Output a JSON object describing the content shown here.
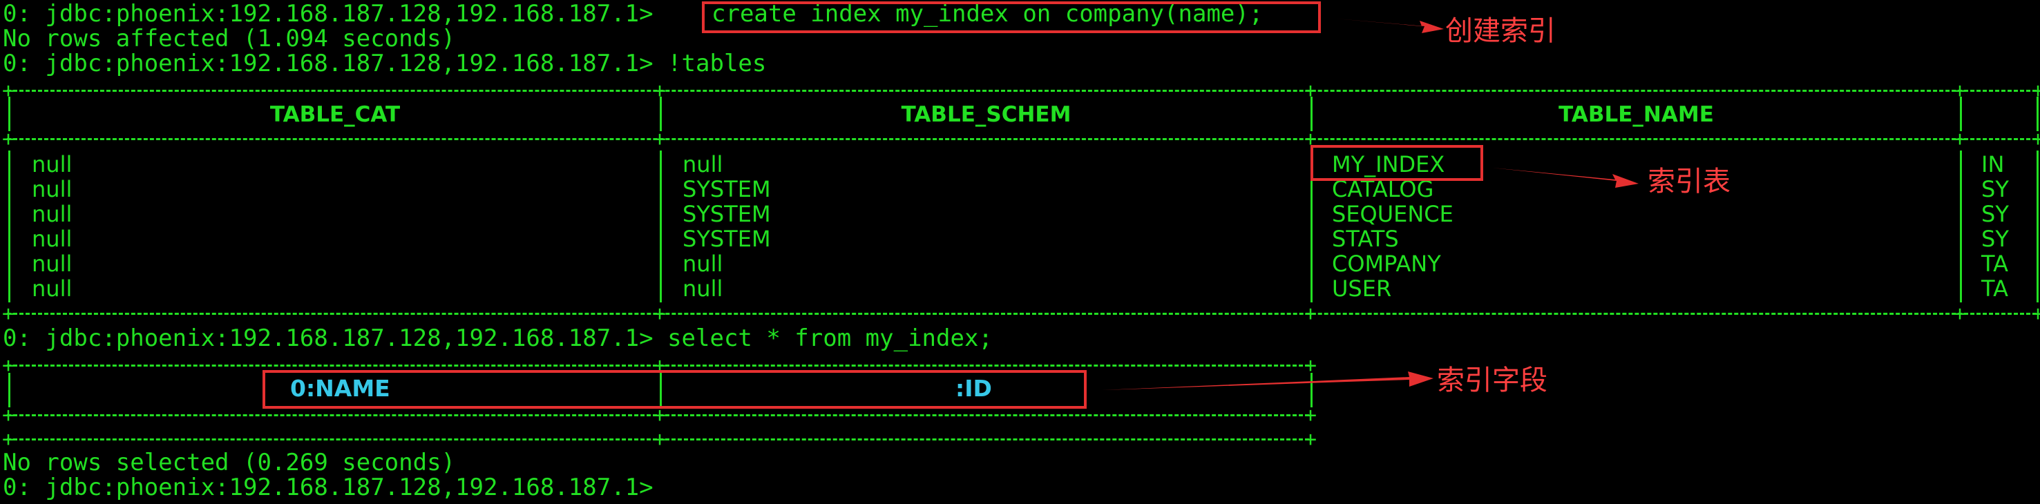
{
  "terminal": {
    "lines": {
      "prompt1": "0: jdbc:phoenix:192.168.187.128,192.168.187.1>",
      "command1": "create index my_index on company(name);",
      "result1": "No rows affected (1.094 seconds)",
      "prompt2": "0: jdbc:phoenix:192.168.187.128,192.168.187.1> !tables",
      "prompt3": "0: jdbc:phoenix:192.168.187.128,192.168.187.1> select * from my_index;",
      "result3": "No rows selected (0.269 seconds)",
      "prompt4": "0: jdbc:phoenix:192.168.187.128,192.168.187.1>"
    },
    "tables_result": {
      "columns": [
        "TABLE_CAT",
        "TABLE_SCHEM",
        "TABLE_NAME"
      ],
      "rows": [
        {
          "cat": "null",
          "schem": "null",
          "name": "MY_INDEX",
          "type": "IN"
        },
        {
          "cat": "null",
          "schem": "SYSTEM",
          "name": "CATALOG",
          "type": "SY"
        },
        {
          "cat": "null",
          "schem": "SYSTEM",
          "name": "SEQUENCE",
          "type": "SY"
        },
        {
          "cat": "null",
          "schem": "SYSTEM",
          "name": "STATS",
          "type": "SY"
        },
        {
          "cat": "null",
          "schem": "null",
          "name": "COMPANY",
          "type": "TA"
        },
        {
          "cat": "null",
          "schem": "null",
          "name": "USER",
          "type": "TA"
        }
      ]
    },
    "index_result": {
      "columns": [
        "0:NAME",
        ":ID"
      ]
    }
  },
  "annotations": {
    "create_index": "创建索引",
    "index_table": "索引表",
    "index_fields": "索引字段"
  },
  "colors": {
    "background": "#000000",
    "terminal_text": "#22e022",
    "header_cyan": "#37c8e8",
    "annotation_red": "#e53030"
  }
}
